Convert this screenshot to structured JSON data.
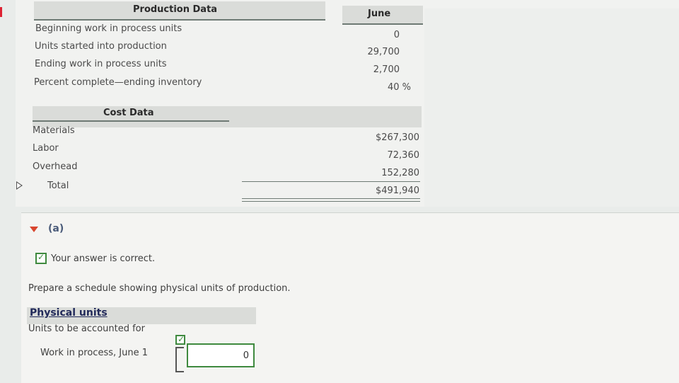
{
  "production": {
    "header": "Production Data",
    "column": "June",
    "rows": [
      {
        "label": "Beginning work in process units",
        "value": "0"
      },
      {
        "label": "Units started into production",
        "value": "29,700"
      },
      {
        "label": "Ending work in process units",
        "value": "2,700"
      },
      {
        "label": "Percent complete—ending inventory",
        "value": "40 %"
      }
    ]
  },
  "cost": {
    "header": "Cost Data",
    "rows": [
      {
        "label": "Materials",
        "value": "$267,300"
      },
      {
        "label": "Labor",
        "value": "72,360"
      },
      {
        "label": "Overhead",
        "value": "152,280"
      },
      {
        "label": "Total",
        "value": "$491,940"
      }
    ]
  },
  "part": {
    "label": "(a)",
    "status_message": "Your answer is correct.",
    "prompt": "Prepare a schedule showing physical units of production.",
    "physical_header": "Physical units",
    "subheading": "Units to be accounted for",
    "wip_label": "Work in process, June 1",
    "wip_value": "0"
  },
  "colors": {
    "accent_green": "#3f8a3f",
    "triangle_red": "#d8452e",
    "header_gray": "#dadcd9"
  }
}
